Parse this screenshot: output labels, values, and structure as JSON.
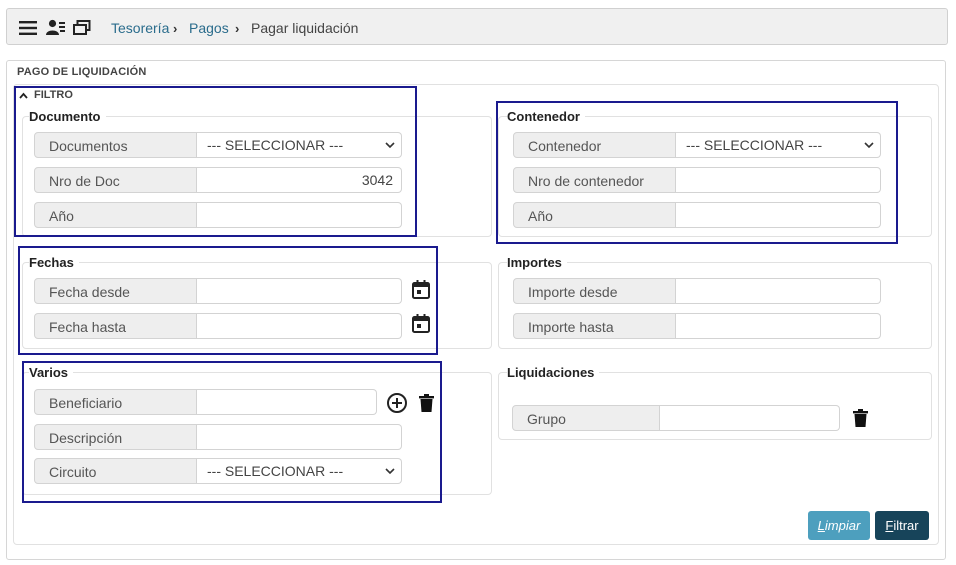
{
  "breadcrumb": {
    "items": [
      "Tesorería",
      "Pagos",
      "Pagar liquidación"
    ]
  },
  "panel": {
    "title": "PAGO DE LIQUIDACIÓN",
    "filter_label": "FILTRO"
  },
  "documento": {
    "title": "Documento",
    "documentos_label": "Documentos",
    "documentos_value": "--- SELECCIONAR ---",
    "nro_label": "Nro de Doc",
    "nro_value": "3042",
    "anio_label": "Año",
    "anio_value": ""
  },
  "contenedor": {
    "title": "Contenedor",
    "contenedor_label": "Contenedor",
    "contenedor_value": "--- SELECCIONAR ---",
    "nro_label": "Nro de contenedor",
    "nro_value": "",
    "anio_label": "Año",
    "anio_value": ""
  },
  "fechas": {
    "title": "Fechas",
    "desde_label": "Fecha desde",
    "desde_value": "",
    "hasta_label": "Fecha hasta",
    "hasta_value": ""
  },
  "importes": {
    "title": "Importes",
    "desde_label": "Importe desde",
    "desde_value": "",
    "hasta_label": "Importe hasta",
    "hasta_value": ""
  },
  "varios": {
    "title": "Varios",
    "beneficiario_label": "Beneficiario",
    "beneficiario_value": "",
    "descripcion_label": "Descripción",
    "descripcion_value": "",
    "circuito_label": "Circuito",
    "circuito_value": "--- SELECCIONAR ---"
  },
  "liquidaciones": {
    "title": "Liquidaciones",
    "grupo_label": "Grupo",
    "grupo_value": ""
  },
  "buttons": {
    "limpiar_first": "L",
    "limpiar_rest": "impiar",
    "filtrar_first": "F",
    "filtrar_rest": "iltrar"
  },
  "colors": {
    "highlight": "#1a1a8e",
    "link": "#2a6c8c",
    "btn_primary": "#17445a",
    "btn_secondary": "#2f8fb3"
  },
  "icons": [
    "menu-icon",
    "user-list-icon",
    "windows-icon",
    "calendar-icon",
    "add-circle-icon",
    "trash-icon",
    "chevron-down-icon",
    "chevron-up-icon"
  ]
}
